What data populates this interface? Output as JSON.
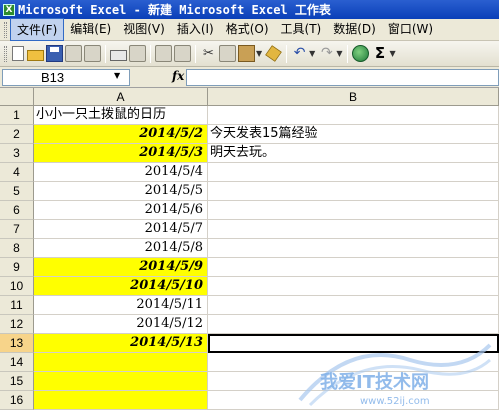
{
  "window": {
    "title": "Microsoft Excel - 新建 Microsoft Excel 工作表"
  },
  "menu": [
    {
      "label": "文件(F)",
      "active": true
    },
    {
      "label": "编辑(E)",
      "active": false
    },
    {
      "label": "视图(V)",
      "active": false
    },
    {
      "label": "插入(I)",
      "active": false
    },
    {
      "label": "格式(O)",
      "active": false
    },
    {
      "label": "工具(T)",
      "active": false
    },
    {
      "label": "数据(D)",
      "active": false
    },
    {
      "label": "窗口(W)",
      "active": false
    }
  ],
  "toolbar": {
    "icons": [
      "new-icon",
      "open-icon",
      "save-icon",
      "permission-icon",
      "email-icon",
      "print-icon",
      "print-preview-icon",
      "spelling-icon",
      "research-icon",
      "cut-icon",
      "copy-icon",
      "paste-icon",
      "format-painter-icon",
      "undo-icon",
      "redo-icon",
      "hyperlink-icon",
      "autosum-icon"
    ],
    "sigma": "Σ"
  },
  "formula_bar": {
    "name_box": "B13",
    "fx": "fx",
    "formula": ""
  },
  "columns": [
    {
      "label": "A",
      "selected": false
    },
    {
      "label": "B",
      "selected": false
    }
  ],
  "rows": [
    {
      "num": "1",
      "a": "小小一只土拨鼠的日历",
      "b": "",
      "yellow": false,
      "style": "left"
    },
    {
      "num": "2",
      "a": "2014/5/2",
      "b": "今天发表15篇经验",
      "yellow": true,
      "style": "bi"
    },
    {
      "num": "3",
      "a": "2014/5/3",
      "b": "明天去玩。",
      "yellow": true,
      "style": "bi"
    },
    {
      "num": "4",
      "a": "2014/5/4",
      "b": "",
      "yellow": false,
      "style": "plain"
    },
    {
      "num": "5",
      "a": "2014/5/5",
      "b": "",
      "yellow": false,
      "style": "plain"
    },
    {
      "num": "6",
      "a": "2014/5/6",
      "b": "",
      "yellow": false,
      "style": "plain"
    },
    {
      "num": "7",
      "a": "2014/5/7",
      "b": "",
      "yellow": false,
      "style": "plain"
    },
    {
      "num": "8",
      "a": "2014/5/8",
      "b": "",
      "yellow": false,
      "style": "plain"
    },
    {
      "num": "9",
      "a": "2014/5/9",
      "b": "",
      "yellow": true,
      "style": "bi"
    },
    {
      "num": "10",
      "a": "2014/5/10",
      "b": "",
      "yellow": true,
      "style": "bi"
    },
    {
      "num": "11",
      "a": "2014/5/11",
      "b": "",
      "yellow": false,
      "style": "plain"
    },
    {
      "num": "12",
      "a": "2014/5/12",
      "b": "",
      "yellow": false,
      "style": "plain"
    },
    {
      "num": "13",
      "a": "2014/5/13",
      "b": "",
      "yellow": true,
      "style": "bi",
      "selected": true
    },
    {
      "num": "14",
      "a": "",
      "b": "",
      "yellow": true,
      "style": "plain"
    },
    {
      "num": "15",
      "a": "",
      "b": "",
      "yellow": true,
      "style": "plain"
    },
    {
      "num": "16",
      "a": "",
      "b": "",
      "yellow": true,
      "style": "plain"
    }
  ],
  "active_cell": "B13",
  "colors": {
    "highlight": "#ffff00",
    "title_bar": "#0a3fb8",
    "selected_header": "#f7d48a"
  },
  "watermark": {
    "text": "我爱IT技术网",
    "url": "www.52ij.com"
  }
}
